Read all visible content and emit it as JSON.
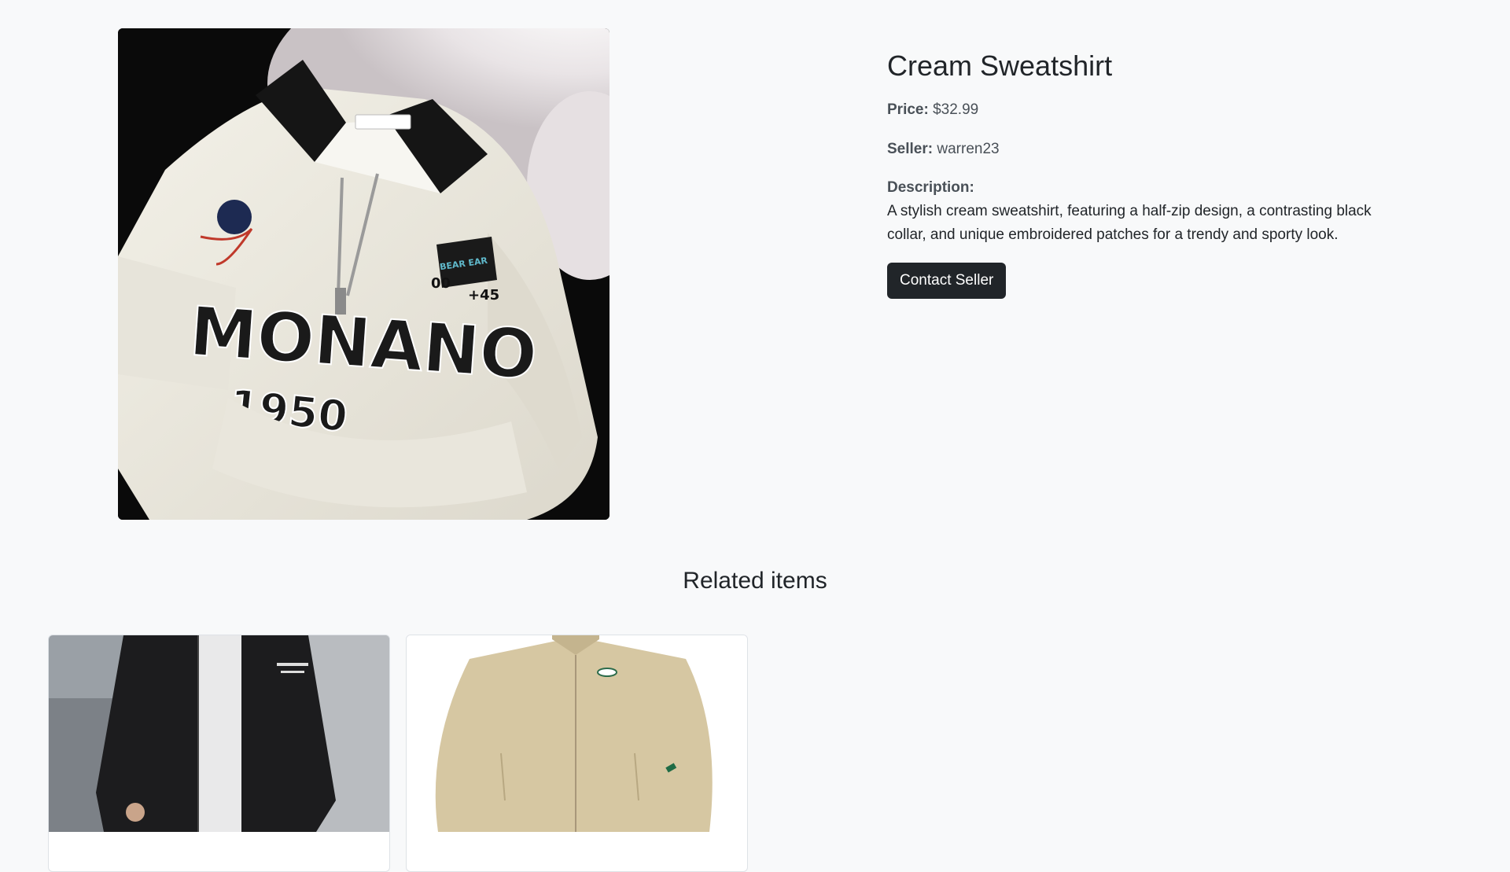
{
  "product": {
    "title": "Cream Sweatshirt",
    "price_label": "Price:",
    "price": "$32.99",
    "seller_label": "Seller:",
    "seller": "warren23",
    "description_label": "Description:",
    "description": "A stylish cream sweatshirt, featuring a half-zip design, a contrasting black collar, and unique embroidered patches for a trendy and sporty look.",
    "contact_button": "Contact Seller",
    "image_print_text": "MONANO",
    "image_print_year": "1950",
    "image_patch_text": "BEAR EAR",
    "image_patch_number": "+45",
    "image_patch_number_2": "00"
  },
  "related": {
    "title": "Related items",
    "items": [
      {
        "image_alt": "black jacket"
      },
      {
        "image_alt": "beige jacket"
      }
    ]
  },
  "colors": {
    "page_bg": "#f8f9fa",
    "button_bg": "#212529",
    "sweatshirt": "#efece2",
    "collar": "#151515",
    "beige_jacket": "#d6c7a2",
    "black_jacket": "#1c1c1e"
  }
}
